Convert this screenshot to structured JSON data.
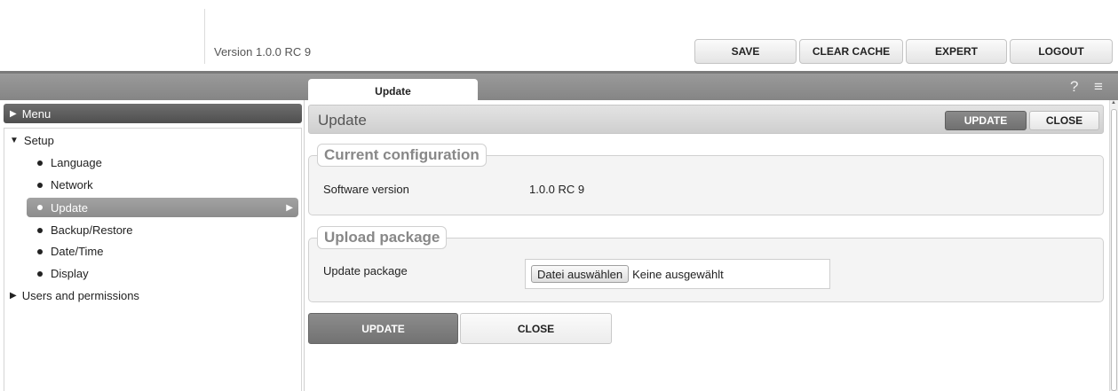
{
  "header": {
    "version": "Version 1.0.0 RC 9",
    "buttons": {
      "save": "SAVE",
      "clear_cache": "CLEAR CACHE",
      "expert": "EXPERT",
      "logout": "LOGOUT"
    }
  },
  "tabbar": {
    "active_tab": "Update",
    "icons": {
      "help": "?",
      "menu": "≡"
    }
  },
  "sidebar": {
    "menu_label": "Menu",
    "setup_label": "Setup",
    "items": [
      {
        "label": "Language"
      },
      {
        "label": "Network"
      },
      {
        "label": "Update",
        "selected": true
      },
      {
        "label": "Backup/Restore"
      },
      {
        "label": "Date/Time"
      },
      {
        "label": "Display"
      }
    ],
    "users_label": "Users and permissions"
  },
  "content": {
    "title": "Update",
    "title_buttons": {
      "update": "UPDATE",
      "close": "CLOSE"
    },
    "current_config": {
      "legend": "Current configuration",
      "software_version_label": "Software version",
      "software_version_value": "1.0.0 RC 9"
    },
    "upload": {
      "legend": "Upload package",
      "package_label": "Update package",
      "choose_button": "Datei auswählen",
      "file_status": "Keine ausgewählt"
    },
    "bottom_buttons": {
      "update": "UPDATE",
      "close": "CLOSE"
    }
  },
  "colors": {
    "tabbar": "#8e8e8e",
    "menu_header": "#5a5a5a",
    "selected_item": "#979797",
    "section_bg": "#f4f4f4"
  }
}
